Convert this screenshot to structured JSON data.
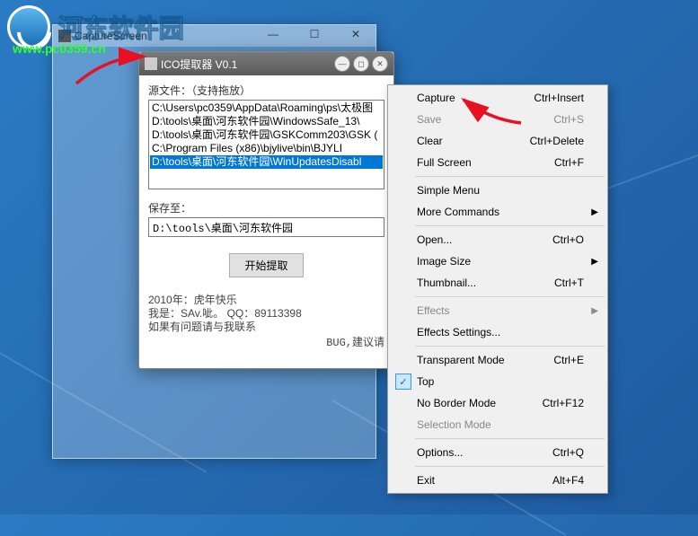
{
  "watermark": {
    "text": "河东软件园",
    "url": "www.pc0359.cn"
  },
  "capture_window": {
    "title": "CaptureScreen"
  },
  "ico_window": {
    "title": "ICO提取器 V0.1",
    "source_label": "源文件：（支持拖放）",
    "files": [
      "C:\\Users\\pc0359\\AppData\\Roaming\\ps\\太极图",
      "D:\\tools\\桌面\\河东软件园\\WindowsSafe_13\\",
      "D:\\tools\\桌面\\河东软件园\\GSKComm203\\GSK (",
      "C:\\Program Files (x86)\\bjylive\\bin\\BJYLI",
      "D:\\tools\\桌面\\河东软件园\\WinUpdatesDisabl"
    ],
    "selected_index": 4,
    "save_label": "保存至：",
    "save_path": "D:\\tools\\桌面\\河东软件园",
    "extract_button": "开始提取",
    "footer": [
      "2010年：虎年快乐",
      "我是：SAv.呲。 QQ：89113398",
      "如果有问题请与我联系"
    ],
    "bug_text": "BUG,建议请"
  },
  "menu": {
    "items": [
      {
        "label": "Capture",
        "shortcut": "Ctrl+Insert",
        "type": "item"
      },
      {
        "label": "Save",
        "shortcut": "Ctrl+S",
        "type": "item",
        "disabled": true
      },
      {
        "label": "Clear",
        "shortcut": "Ctrl+Delete",
        "type": "item"
      },
      {
        "label": "Full Screen",
        "shortcut": "Ctrl+F",
        "type": "item"
      },
      {
        "type": "sep"
      },
      {
        "label": "Simple Menu",
        "type": "item"
      },
      {
        "label": "More Commands",
        "type": "submenu"
      },
      {
        "type": "sep"
      },
      {
        "label": "Open...",
        "shortcut": "Ctrl+O",
        "type": "item"
      },
      {
        "label": "Image Size",
        "type": "submenu"
      },
      {
        "label": "Thumbnail...",
        "shortcut": "Ctrl+T",
        "type": "item"
      },
      {
        "type": "sep"
      },
      {
        "label": "Effects",
        "type": "submenu",
        "disabled": true
      },
      {
        "label": "Effects Settings...",
        "type": "item"
      },
      {
        "type": "sep"
      },
      {
        "label": "Transparent Mode",
        "shortcut": "Ctrl+E",
        "type": "item"
      },
      {
        "label": "Top",
        "type": "item",
        "checked": true
      },
      {
        "label": "No Border Mode",
        "shortcut": "Ctrl+F12",
        "type": "item"
      },
      {
        "label": "Selection Mode",
        "type": "item",
        "disabled": true
      },
      {
        "type": "sep"
      },
      {
        "label": "Options...",
        "shortcut": "Ctrl+Q",
        "type": "item"
      },
      {
        "type": "sep"
      },
      {
        "label": "Exit",
        "shortcut": "Alt+F4",
        "type": "item"
      }
    ]
  }
}
